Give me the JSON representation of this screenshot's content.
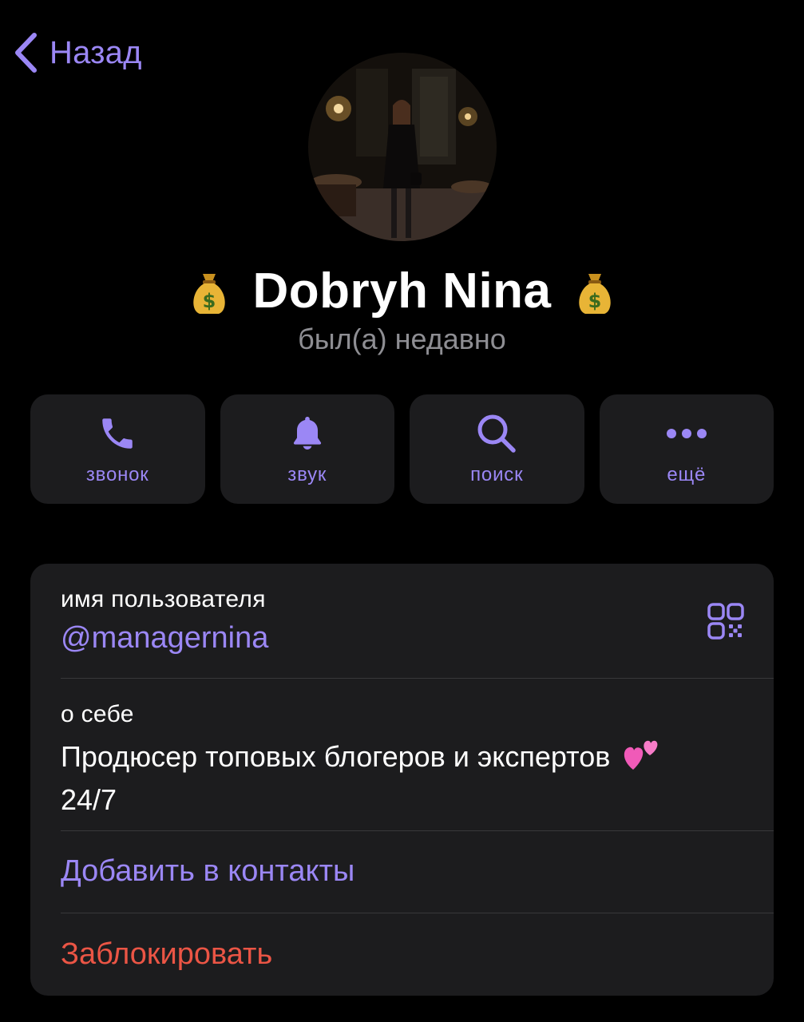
{
  "header": {
    "back_label": "Назад"
  },
  "profile": {
    "name": "Dobryh Nina",
    "name_emoji_icon": "money-bag-icon",
    "status": "был(а) недавно"
  },
  "actions": [
    {
      "label": "звонок",
      "icon": "phone-icon"
    },
    {
      "label": "звук",
      "icon": "bell-icon"
    },
    {
      "label": "поиск",
      "icon": "search-icon"
    },
    {
      "label": "ещё",
      "icon": "more-icon"
    }
  ],
  "info": {
    "username_label": "имя пользователя",
    "username_value": "@managernina",
    "qr_icon": "qr-code-icon",
    "bio_label": "о себе",
    "bio_line1": "Продюсер топовых блогеров и экспертов",
    "bio_emoji_icon": "two-hearts-icon",
    "bio_line2": "24/7",
    "add_contact": "Добавить в контакты",
    "block": "Заблокировать"
  },
  "colors": {
    "background": "#000000",
    "card": "#1c1c1e",
    "accent": "#9b87f5",
    "destructive": "#eb5545",
    "secondary_text": "#8e8e93"
  }
}
